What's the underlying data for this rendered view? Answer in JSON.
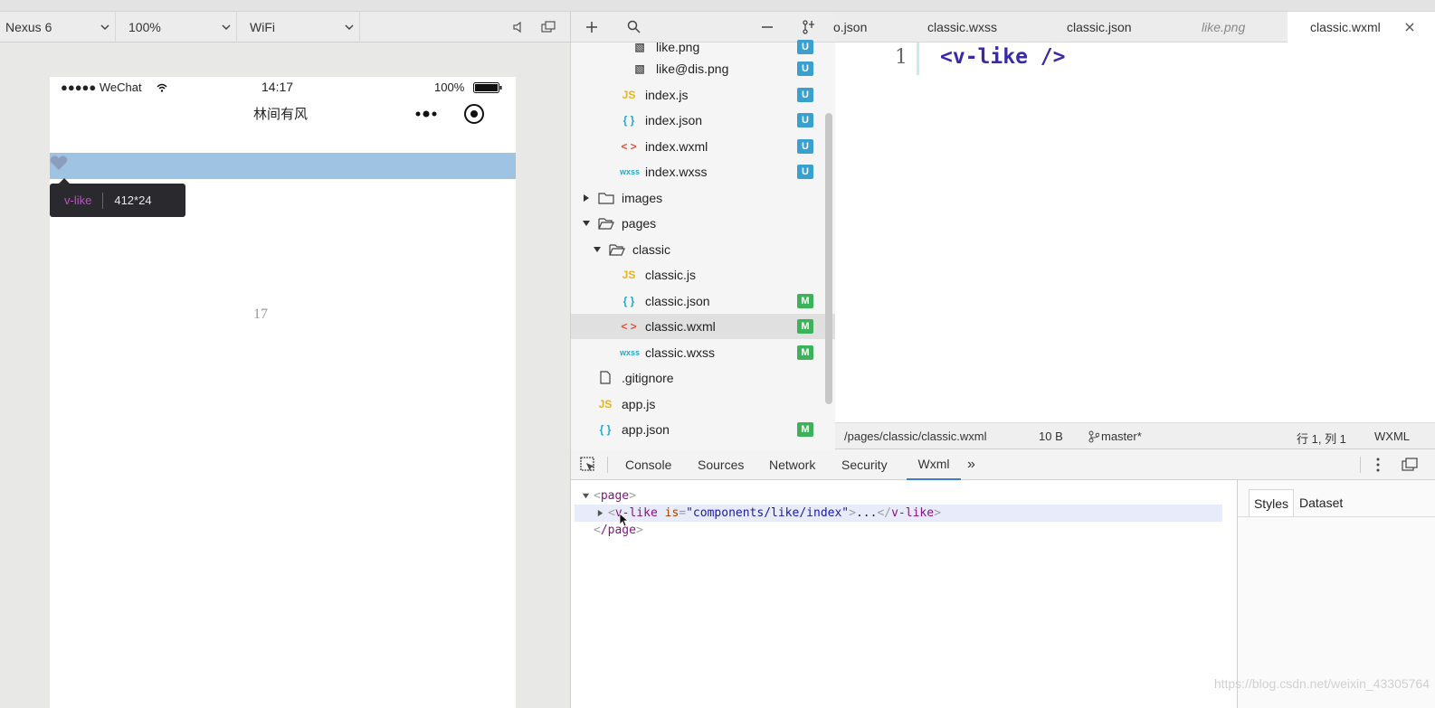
{
  "simulator": {
    "device": "Nexus 6",
    "zoom": "100%",
    "network": "WiFi",
    "status": {
      "carrier": "●●●●● WeChat",
      "time": "14:17",
      "battery": "100%"
    },
    "nav_title": "林间有风",
    "tooltip": {
      "tag": "v-like",
      "size": "412*24"
    },
    "count": "17"
  },
  "tree": {
    "items": [
      {
        "name": "like.png",
        "icon": "image-icon",
        "badge": "U"
      },
      {
        "name": "like@dis.png",
        "icon": "image-icon",
        "badge": "U"
      },
      {
        "name": "index.js",
        "icon": "JS",
        "badge": "U"
      },
      {
        "name": "index.json",
        "icon": "{ }",
        "badge": "U"
      },
      {
        "name": "index.wxml",
        "icon": "< >",
        "badge": "U"
      },
      {
        "name": "index.wxss",
        "icon": "wxss",
        "badge": "U"
      },
      {
        "name": "images",
        "icon": "folder-icon",
        "badge": ""
      },
      {
        "name": "pages",
        "icon": "folder-open-icon",
        "badge": ""
      },
      {
        "name": "classic",
        "icon": "folder-open-icon",
        "badge": ""
      },
      {
        "name": "classic.js",
        "icon": "JS",
        "badge": ""
      },
      {
        "name": "classic.json",
        "icon": "{ }",
        "badge": "M"
      },
      {
        "name": "classic.wxml",
        "icon": "< >",
        "badge": "M"
      },
      {
        "name": "classic.wxss",
        "icon": "wxss",
        "badge": "M"
      },
      {
        "name": ".gitignore",
        "icon": "file-icon",
        "badge": ""
      },
      {
        "name": "app.js",
        "icon": "JS",
        "badge": ""
      },
      {
        "name": "app.json",
        "icon": "{ }",
        "badge": "M"
      }
    ]
  },
  "editor": {
    "tabs": [
      "o.json",
      "classic.wxss",
      "classic.json",
      "like.png",
      "classic.wxml"
    ],
    "line_number": "1",
    "code": "<v-like />",
    "status": {
      "path": "/pages/classic/classic.wxml",
      "size": "10 B",
      "branch": "master*",
      "position": "行 1, 列 1",
      "lang": "WXML"
    }
  },
  "devtools": {
    "tabs": [
      "Console",
      "Sources",
      "Network",
      "Security",
      "Wxml"
    ],
    "more": "»",
    "wxml": {
      "page_open": "page",
      "child_tag": "v-like",
      "child_attr": "is",
      "child_val": "\"components/like/index\"",
      "child_ellipsis": "...",
      "page_close": "/page"
    },
    "side_tabs": [
      "Styles",
      "Dataset"
    ]
  },
  "watermark": "https://blog.csdn.net/weixin_43305764",
  "colors": {
    "highlight": "#9fc3e3",
    "badge_u": "#3aa0d0",
    "badge_m": "#3cb35a",
    "tag": "#881280"
  }
}
